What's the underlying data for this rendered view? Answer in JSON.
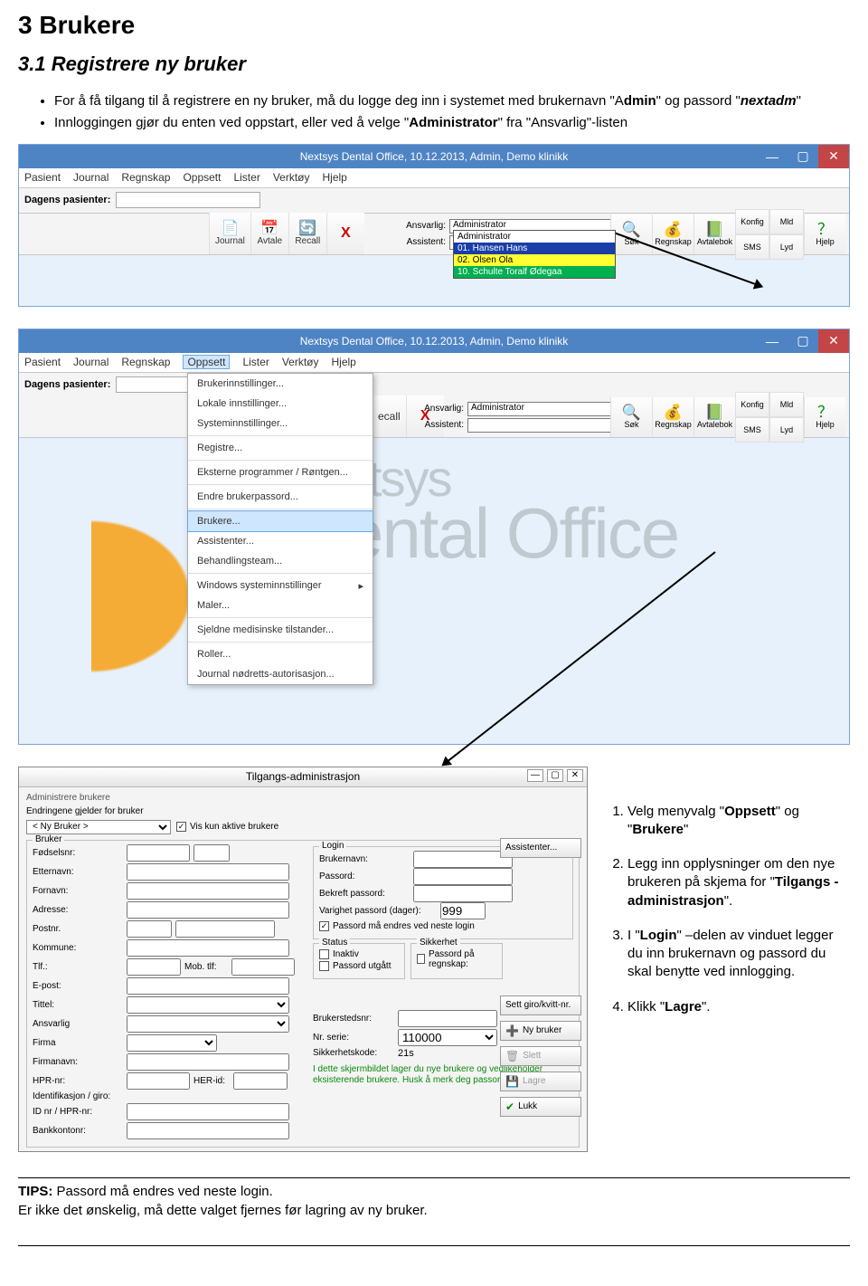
{
  "doc": {
    "h1": "3  Brukere",
    "h2": "3.1  Registrere ny bruker",
    "bullets": [
      "For å få tilgang til å registrere en ny bruker, må du logge deg inn i systemet med brukernavn \"Admin\" og passord \"nextadm\"",
      "Innloggingen gjør du enten ved oppstart, eller ved å velge \"Administrator\" fra \"Ansvarlig\"-listen"
    ],
    "bullet0_parts": [
      "For å få tilgang til å registrere en ny bruker, må du logge deg inn i systemet med brukernavn \"A",
      "dmin",
      "\" og passord \"",
      "nextadm",
      "\""
    ],
    "bullet1_parts": [
      "Innloggingen gjør du enten ved oppstart, eller ved å velge \"",
      "Administrator",
      "\" fra \"Ansvarlig\"-listen"
    ],
    "instructions": [
      "Velg menyvalg \"Oppsett\" og \"Brukere\"",
      "Legg inn opplysninger om den nye brukeren på skjema for \"Tilgangs - administrasjon\".",
      "I \"Login\" –delen av vinduet legger du inn brukernavn og passord du skal benytte ved innlogging.",
      "Klikk \"Lagre\"."
    ],
    "instr1_parts": [
      "Velg menyvalg \"",
      "Oppsett",
      "\" og \"",
      "Brukere",
      "\""
    ],
    "instr2_parts": [
      "Legg inn opplysninger om den nye brukeren på skjema for \"",
      "Tilgangs - administrasjon",
      "\"."
    ],
    "instr3_parts": [
      "I \"",
      "Login",
      "\" –delen av vinduet legger du inn brukernavn og passord du skal benytte ved innlogging."
    ],
    "instr4_parts": [
      "Klikk \"",
      "Lagre",
      "\"."
    ],
    "tips_label": "TIPS:",
    "tips_lines": [
      "Passord må endres ved neste login.",
      "Er ikke det ønskelig, må dette valget fjernes før lagring av ny bruker."
    ]
  },
  "app": {
    "title": "Nextsys Dental Office,  10.12.2013, Admin, Demo klinikk",
    "menus": [
      "Pasient",
      "Journal",
      "Regnskap",
      "Oppsett",
      "Lister",
      "Verktøy",
      "Hjelp"
    ],
    "dagens": "Dagens pasienter:",
    "tbtns": {
      "journal": "Journal",
      "avtale": "Avtale",
      "recall": "Recall",
      "x": "X"
    },
    "resp": {
      "ansvarlig": "Ansvarlig:",
      "assistent": "Assistent:",
      "ansvarlig_val": "Administrator",
      "assistent_val": ""
    },
    "ansvarlig_list": [
      "Administrator",
      "01. Hansen Hans",
      "02. Olsen Ola",
      "10. Schulte Toralf Ødegaa"
    ],
    "right": {
      "sok": "Søk",
      "regnskap": "Regnskap",
      "avtalebok": "Avtalebok",
      "konfig": "Konfig",
      "mld": "Mld",
      "sms": "SMS",
      "lyd": "Lyd",
      "hjelp": "Hjelp"
    },
    "brand1": "xtsys",
    "brand2": "ental Office"
  },
  "oppsett_menu": [
    "Brukerinnstillinger...",
    "Lokale innstillinger...",
    "Systeminnstillinger...",
    "-",
    "Registre...",
    "-",
    "Eksterne programmer / Røntgen...",
    "-",
    "Endre brukerpassord...",
    "-",
    "Brukere...",
    "Assistenter...",
    "Behandlingsteam...",
    "-",
    "Windows systeminnstillinger",
    "Maler...",
    "-",
    "Sjeldne medisinske tilstander...",
    "-",
    "Roller...",
    "Journal nødretts-autorisasjon..."
  ],
  "oppsett_menu_selected": "Brukere...",
  "oppsett_menu_arrow": "Windows systeminnstillinger",
  "dialog": {
    "title": "Tilgangs-administrasjon",
    "admin_row": "Administrere brukere",
    "endr": "Endringene gjelder for bruker",
    "ny_bruker": "< Ny Bruker >",
    "vis_aktive": "Vis kun aktive brukere",
    "group_bruker": "Bruker",
    "left_labels": {
      "fodselsnr": "Fødselsnr:",
      "etternavn": "Etternavn:",
      "fornavn": "Fornavn:",
      "adresse": "Adresse:",
      "postnr": "Postnr.",
      "kommune": "Kommune:",
      "tlf": "Tlf.:",
      "mob": "Mob. tlf:",
      "epost": "E-post:",
      "tittel": "Tittel:",
      "ansvarlig": "Ansvarlig",
      "firma": "Firma",
      "firmanavn": "Firmanavn:",
      "hpr": "HPR-nr:",
      "her": "HER-id:",
      "ident": "Identifikasjon / giro:",
      "idnr": "ID nr / HPR-nr:",
      "bank": "Bankkontonr:"
    },
    "login": {
      "title": "Login",
      "brukernavn": "Brukernavn:",
      "passord": "Passord:",
      "bekreft": "Bekreft passord:",
      "varighet": "Varighet passord (dager):",
      "varighet_val": "999",
      "endre": "Passord må endres ved neste login"
    },
    "status": {
      "title": "Status",
      "inaktiv": "Inaktiv",
      "utgatt": "Passord utgått"
    },
    "sikkerhet": {
      "title": "Sikkerhet",
      "pa_regnskap": "Passord på regnskap:"
    },
    "brukersted": {
      "label": "Brukerstedsnr:",
      "nrserie": "Nr. serie:",
      "nrserie_val": "110000",
      "sikkerhet": "Sikkerhetskode:",
      "sikkerhet_val": "21s"
    },
    "info": "I dette skjermbildet lager du nye brukere og vedlikeholder eksisterende brukere. Husk å merk deg passordet du setter!",
    "side": {
      "assist": "Assistenter...",
      "giro": "Sett giro/kvitt-nr.",
      "ny": "Ny bruker",
      "slett": "Slett",
      "lagre": "Lagre",
      "lukk": "Lukk"
    }
  }
}
